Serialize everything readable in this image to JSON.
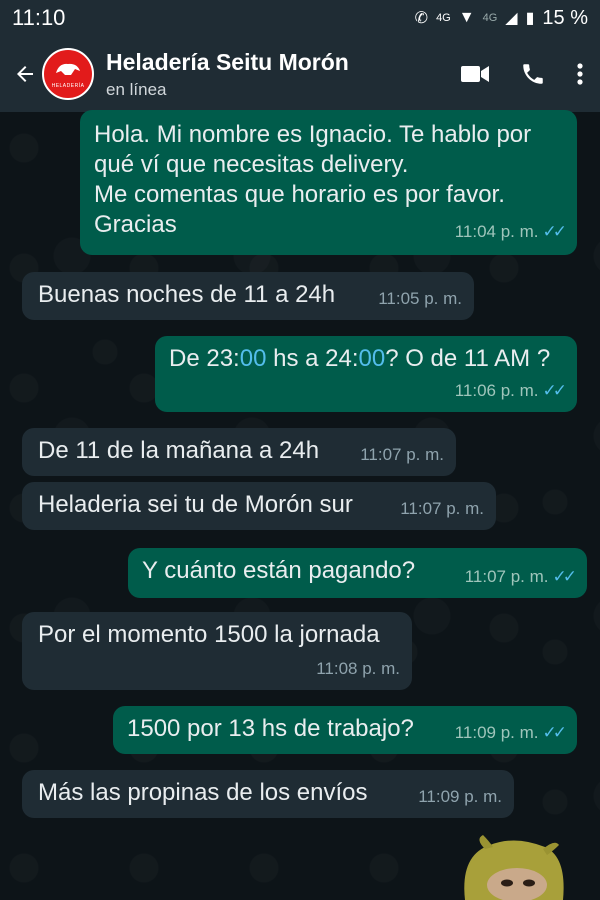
{
  "status_bar": {
    "time": "11:10",
    "network": "4G",
    "network2": "4G",
    "battery": "15 %"
  },
  "header": {
    "avatar_text": "HELADERÍA",
    "contact_name": "Heladería Seitu Morón",
    "status": "en línea"
  },
  "messages": [
    {
      "direction": "out",
      "lines": [
        "Hola. Mi nombre es Ignacio. Te hablo por",
        "qué ví que necesitas delivery.",
        "Me comentas que horario es por favor.",
        "Gracias"
      ],
      "time": "11:04 p. m."
    },
    {
      "direction": "in",
      "text": "Buenas noches de 11 a 24h",
      "time": "11:05 p. m."
    },
    {
      "direction": "out",
      "parts": [
        "De 23:",
        "00",
        " hs a 24:",
        "00",
        "? O de 11 AM ?"
      ],
      "time": "11:06 p. m."
    },
    {
      "direction": "in",
      "text": "De 11 de la mañana a 24h",
      "time": "11:07 p. m."
    },
    {
      "direction": "in",
      "text": "Heladeria sei tu de Morón sur",
      "time": "11:07 p. m."
    },
    {
      "direction": "out",
      "text": "Y cuánto están pagando?",
      "time": "11:07 p. m."
    },
    {
      "direction": "in",
      "text": "Por el momento 1500 la jornada",
      "time": "11:08 p. m."
    },
    {
      "direction": "out",
      "text": "1500 por 13 hs de trabajo?",
      "time": "11:09 p. m."
    },
    {
      "direction": "in",
      "text": "Más las propinas de los envíos",
      "time": "11:09 p. m."
    }
  ],
  "colors": {
    "outgoing_bubble": "#005c4b",
    "incoming_bubble": "#1f2c34",
    "header": "#1f2c34",
    "read_ticks": "#53bdeb"
  }
}
